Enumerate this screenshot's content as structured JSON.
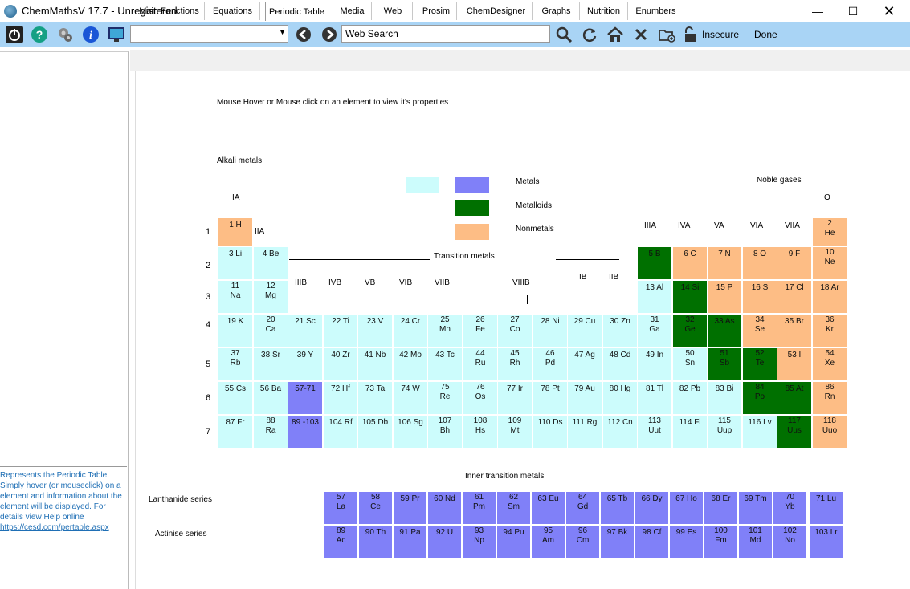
{
  "window": {
    "title": "ChemMathsV 17.7 - Unregistered"
  },
  "toolbar": {
    "address_value": "",
    "search_value": "Web Search",
    "insecure_label": "Insecure",
    "done_label": "Done"
  },
  "tabs": [
    "Main Functions",
    "Equations",
    "Periodic Table",
    "Media",
    "Web",
    "Prosim",
    "ChemDesigner",
    "Graphs",
    "Nutrition",
    "Enumbers"
  ],
  "active_tab": "Periodic Table",
  "left_panel": {
    "description": "Represents the Periodic Table. Simply hover (or mouseclick) on a element and information about the element will be displayed. For details view Help online",
    "link": "https://cesd.com/pertable.aspx"
  },
  "periodic": {
    "instruction": "Mouse Hover or Mouse click on an element to view it's properties",
    "alkali_label": "Alkali metals",
    "noble_label": "Noble gases",
    "transition_label": "Transition metals",
    "inner_label": "Inner transition metals",
    "lanthanide_label": "Lanthanide series",
    "actinide_label": "Actinise series",
    "legend": {
      "metals": "Metals",
      "metalloids": "Metalloids",
      "nonmetals": "Nonmetals"
    },
    "group_labels": [
      "IA",
      "IIA",
      "IIIB",
      "IVB",
      "VB",
      "VIB",
      "VIIB",
      "VIIIB",
      "IB",
      "IIB",
      "IIIA",
      "IVA",
      "VA",
      "VIA",
      "VIIA",
      "O"
    ],
    "period_labels": [
      "1",
      "2",
      "3",
      "4",
      "5",
      "6",
      "7"
    ],
    "colors": {
      "metal": "#ccfcfc",
      "lanthanide": "#8080f8",
      "metalloid": "#007000",
      "nonmetal": "#fdbd85"
    }
  }
}
